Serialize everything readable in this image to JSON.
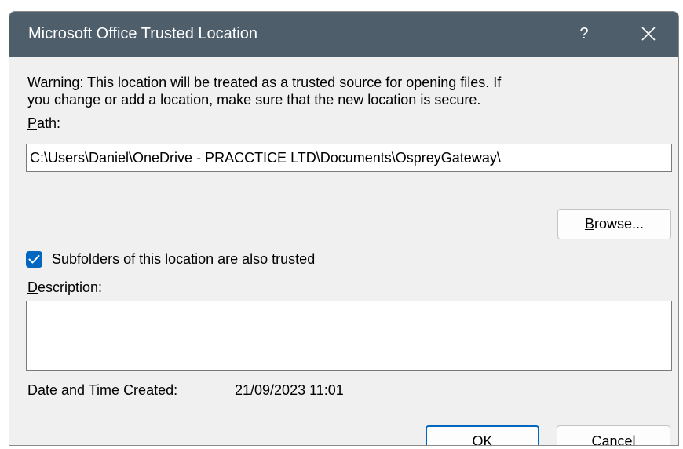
{
  "window": {
    "title": "Microsoft Office Trusted Location",
    "help_label": "?",
    "close_icon": "close-icon"
  },
  "warning": {
    "line1": "Warning: This location will be treated as a trusted source for opening files. If",
    "line2": "you change or add a location, make sure that the new location is secure."
  },
  "path": {
    "label_first": "P",
    "label_rest": "ath:",
    "value": "C:\\Users\\Daniel\\OneDrive - PRACCTICE LTD\\Documents\\OspreyGateway\\"
  },
  "browse": {
    "label_first": "B",
    "label_rest": "rowse..."
  },
  "subfolders": {
    "checked": true,
    "label_first": "S",
    "label_rest": "ubfolders of this location are also trusted"
  },
  "description": {
    "label_first": "D",
    "label_rest": "escription:",
    "value": ""
  },
  "created": {
    "label": "Date and Time Created:",
    "value": "21/09/2023 11:01"
  },
  "buttons": {
    "ok": "OK",
    "cancel": "Cancel"
  },
  "colors": {
    "titlebar": "#4f5e6b",
    "accent": "#0067c0",
    "dialog_bg": "#f0f0f0"
  }
}
